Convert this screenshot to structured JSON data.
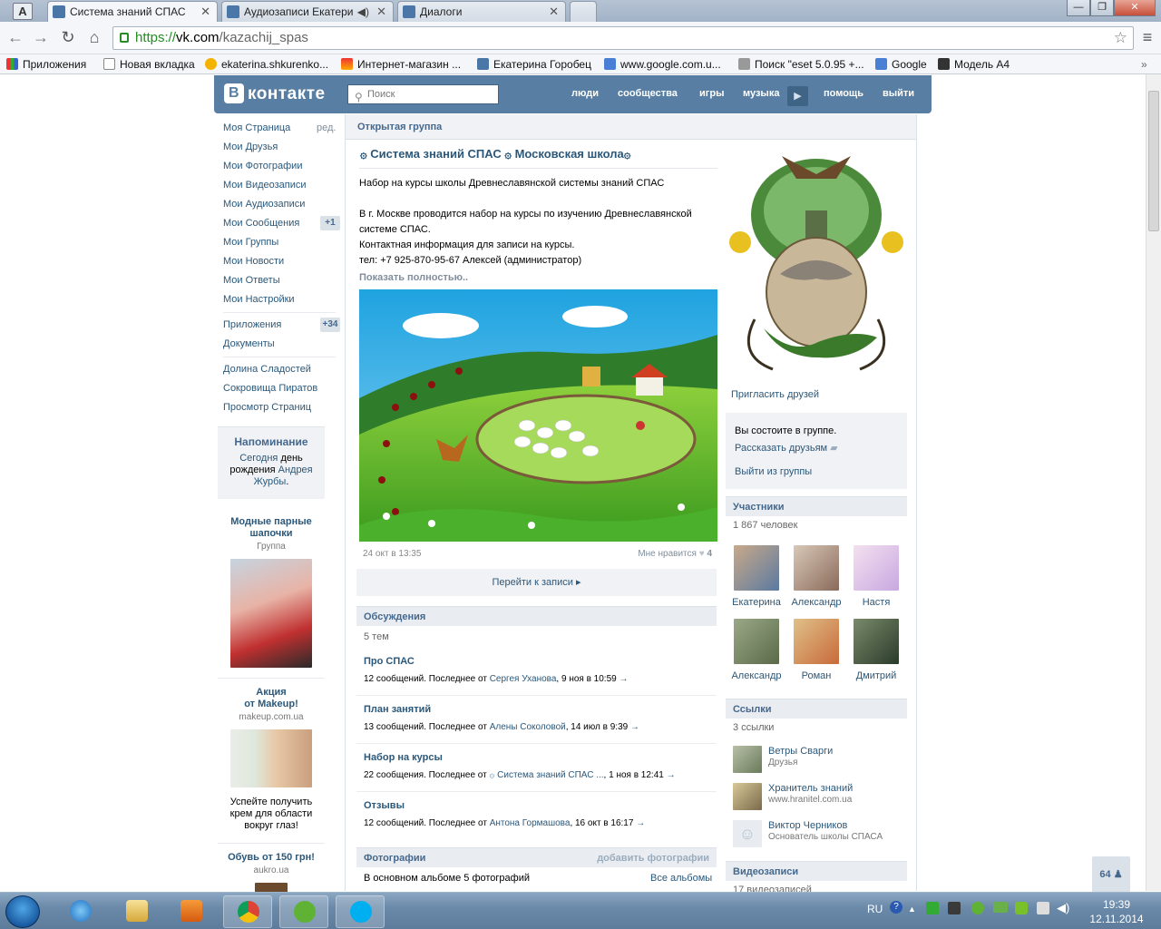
{
  "browser": {
    "profile_letter": "A",
    "tabs": [
      {
        "title": "Система знаний СПАС",
        "active": true
      },
      {
        "title": "Аудиозаписи Екатери",
        "active": false
      },
      {
        "title": "Диалоги",
        "active": false
      }
    ],
    "url_https": "https://",
    "url_host": "vk.com",
    "url_path": "/kazachij_spas",
    "bookmarks": [
      "Приложения",
      "Новая вкладка",
      "ekaterina.shkurenko...",
      "Интернет-магазин ...",
      "Екатерина Горобец",
      "www.google.com.u...",
      "Поиск \"eset 5.0.95 +...",
      "Google",
      "Модель А4"
    ]
  },
  "header": {
    "logo_letter": "B",
    "logo_text": "контакте",
    "search_placeholder": "Поиск",
    "nav": [
      "люди",
      "сообщества",
      "игры",
      "музыка",
      "помощь",
      "выйти"
    ]
  },
  "left_menu": {
    "items": [
      {
        "label": "Моя Страница",
        "extra": "ред."
      },
      {
        "label": "Мои Друзья"
      },
      {
        "label": "Мои Фотографии"
      },
      {
        "label": "Мои Видеозаписи"
      },
      {
        "label": "Мои Аудиозаписи"
      },
      {
        "label": "Мои Сообщения",
        "count": "+1"
      },
      {
        "label": "Мои Группы"
      },
      {
        "label": "Мои Новости"
      },
      {
        "label": "Мои Ответы"
      },
      {
        "label": "Мои Настройки"
      }
    ],
    "items2": [
      {
        "label": "Приложения",
        "count": "+34"
      },
      {
        "label": "Документы"
      }
    ],
    "items3": [
      {
        "label": "Долина Сладостей"
      },
      {
        "label": "Сокровища Пиратов"
      },
      {
        "label": "Просмотр Страниц"
      }
    ],
    "reminder": {
      "title": "Напоминание",
      "today": "Сегодня",
      "day": "день",
      "birthday": "рождения",
      "name1": "Андрея",
      "name2": "Журбы",
      "dot": "."
    },
    "ads": [
      {
        "title1": "Модные парные",
        "title2": "шапочки",
        "sub": "Группа"
      },
      {
        "title1": "Акция",
        "title2": "от Makeup!",
        "sub": "makeup.com.ua",
        "text1": "Успейте получить",
        "text2": "крем для области",
        "text3": "вокруг глаз!"
      },
      {
        "title1": "Обувь от 150 грн!",
        "sub": "aukro.ua"
      }
    ]
  },
  "group": {
    "type_label": "Открытая группа",
    "title": "۞ Система знаний СПАС ۞ Московская школа۞",
    "post_lines": [
      "Набор на курсы школы Древнеславянской системы знаний СПАС",
      "",
      "В г. Москве проводится набор на курсы по изучению Древнеславянской",
      "системе СПАС.",
      "Контактная информация для записи на курсы.",
      "тел: +7 925-870-95-67 Алексей (администратор)"
    ],
    "show_more": "Показать полностью..",
    "post_date": "24 окт в 13:35",
    "like_label": "Мне нравится",
    "like_count": "4",
    "goto_post": "Перейти к записи"
  },
  "discussions": {
    "title": "Обсуждения",
    "count": "5 тем",
    "topics": [
      {
        "title": "Про СПАС",
        "meta": "12 сообщений. Последнее от",
        "author": "Сергея Уханова",
        "date": ", 9 ноя в 10:59"
      },
      {
        "title": "План занятий",
        "meta": "13 сообщений. Последнее от",
        "author": "Алены Соколовой",
        "date": ", 14 июл в 9:39"
      },
      {
        "title": "Набор на курсы",
        "meta": "22 сообщения. Последнее от",
        "author": "۞ Система знаний СПАС ...",
        "date": ", 1 ноя в 12:41"
      },
      {
        "title": "Отзывы",
        "meta": "12 сообщений. Последнее от",
        "author": "Антона Гормашова",
        "date": ", 16 окт в 16:17"
      }
    ]
  },
  "photos": {
    "title": "Фотографии",
    "add": "добавить фотографии",
    "album": "В основном альбоме 5 фотографий",
    "all": "Все альбомы"
  },
  "right": {
    "invite": "Пригласить друзей",
    "member_status": "Вы состоите в группе.",
    "tell_friends": "Рассказать друзьям",
    "leave": "Выйти из группы",
    "members_title": "Участники",
    "members_count": "1 867 человек",
    "members": [
      "Екатерина",
      "Александр",
      "Настя",
      "Александр",
      "Роман",
      "Дмитрий"
    ],
    "links_title": "Ссылки",
    "links_count": "3 ссылки",
    "links": [
      {
        "title": "Ветры Сварги",
        "sub": "Друзья"
      },
      {
        "title": "Хранитель знаний",
        "sub": "www.hranitel.com.ua"
      },
      {
        "title": "Виктор Черников",
        "sub": "Основатель школы СПАСА"
      }
    ],
    "video_title": "Видеозаписи",
    "video_count": "17 видеозаписей",
    "friends_online": "64"
  },
  "taskbar": {
    "lang": "RU",
    "time": "19:39",
    "date": "12.11.2014"
  }
}
